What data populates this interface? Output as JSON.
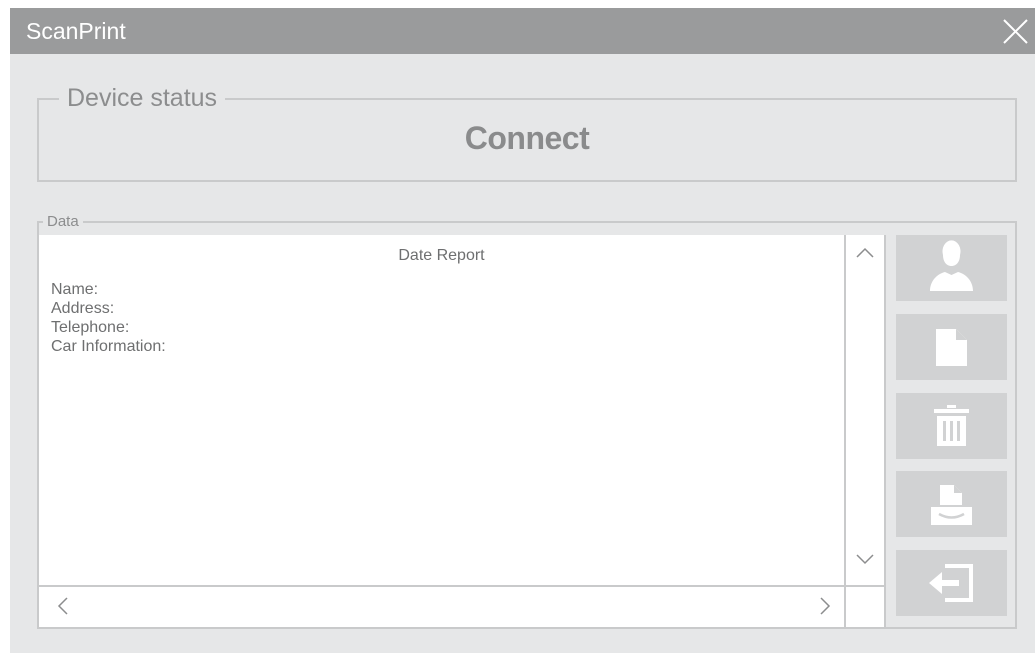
{
  "window": {
    "title": "ScanPrint"
  },
  "device_status": {
    "legend": "Device status",
    "value": "Connect"
  },
  "data_panel": {
    "legend": "Data",
    "report_title": "Date Report",
    "fields": [
      "Name:",
      "Address:",
      "Telephone:",
      "Car Information:"
    ]
  },
  "side_buttons": [
    {
      "icon": "user-icon"
    },
    {
      "icon": "new-document-icon"
    },
    {
      "icon": "trash-icon"
    },
    {
      "icon": "print-icon"
    },
    {
      "icon": "exit-icon"
    }
  ],
  "colors": {
    "titlebar": "#9a9b9c",
    "window_bg": "#e6e7e8",
    "button_bg": "#d1d2d3",
    "text_gray": "#8a8b8c"
  }
}
